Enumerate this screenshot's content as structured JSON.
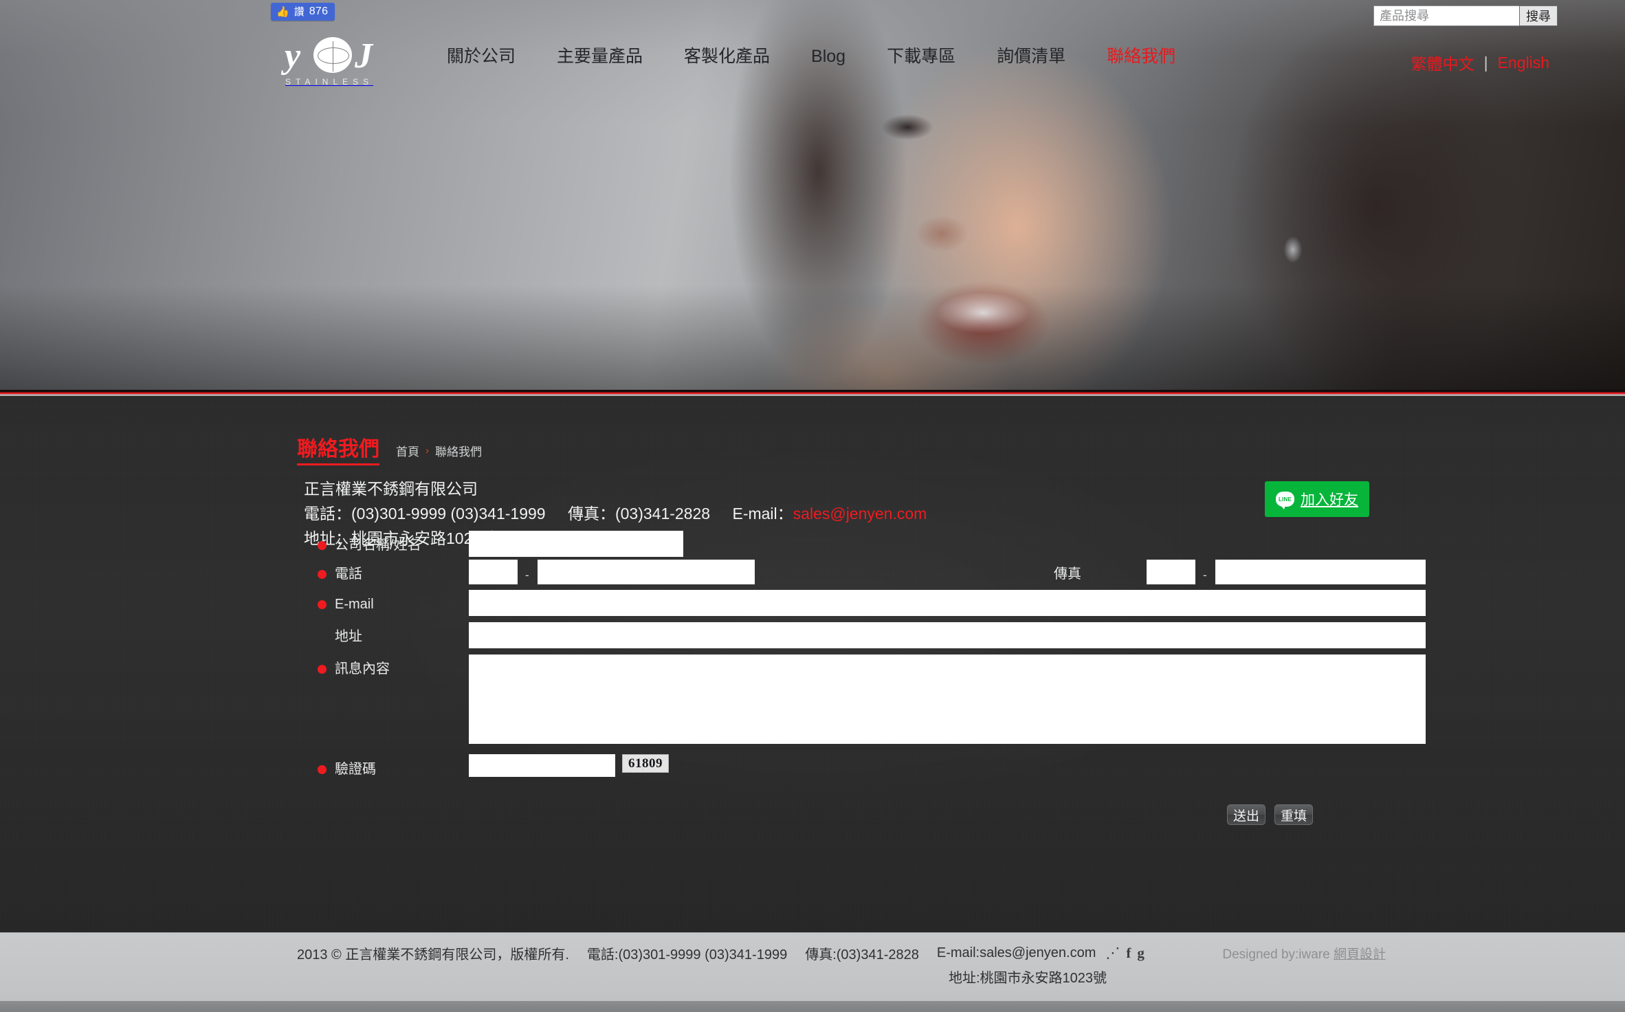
{
  "social_bar": {
    "fb_like_label": "讚",
    "fb_like_count": "876",
    "thumb_icon": "thumbs-up-icon"
  },
  "brand": {
    "logo_text_left": "y",
    "logo_text_right": "J",
    "logo_subtitle": "STAINLESS"
  },
  "nav": {
    "items": [
      {
        "label": "關於公司",
        "accent": false
      },
      {
        "label": "主要量產品",
        "accent": false
      },
      {
        "label": "客製化產品",
        "accent": false
      },
      {
        "label": "Blog",
        "accent": false
      },
      {
        "label": "下載專區",
        "accent": false
      },
      {
        "label": "詢價清單",
        "accent": false
      },
      {
        "label": "聯絡我們",
        "accent": true
      }
    ]
  },
  "search": {
    "placeholder": "產品搜尋",
    "value": "",
    "button_label": "搜尋"
  },
  "lang": {
    "zh_label": "繁體中文",
    "separator": "|",
    "en_label": "English"
  },
  "page": {
    "title": "聯絡我們",
    "breadcrumb_home": "首頁",
    "breadcrumb_arrow": "›",
    "breadcrumb_current": "聯絡我們"
  },
  "company": {
    "name": "正言權業不銹鋼有限公司",
    "phone_label": "電話：",
    "phone_value": "(03)301-9999 (03)341-1999",
    "fax_label": "傳真：",
    "fax_value": "(03)341-2828",
    "email_label": "E-mail：",
    "email_value": "sales@jenyen.com",
    "address_label": "地址：",
    "address_value": "桃園市永安路1023號"
  },
  "line_button": {
    "badge": "LINE",
    "label": "加入好友"
  },
  "form": {
    "company_name": {
      "label": "公司名稱/姓名",
      "required": true,
      "value": ""
    },
    "phone": {
      "label": "電話",
      "required": true,
      "area_value": "",
      "number_value": "",
      "dash": "-"
    },
    "fax": {
      "label": "傳真",
      "required": false,
      "area_value": "",
      "number_value": "",
      "dash": "-"
    },
    "email": {
      "label": "E-mail",
      "required": true,
      "value": ""
    },
    "address": {
      "label": "地址",
      "required": false,
      "value": ""
    },
    "message": {
      "label": "訊息內容",
      "required": true,
      "value": ""
    },
    "captcha": {
      "label": "驗證碼",
      "required": true,
      "value": "",
      "code": "61809"
    },
    "submit_label": "送出",
    "reset_label": "重填"
  },
  "footer": {
    "copyright": "2013 © 正言權業不銹鋼有限公司，版權所有.",
    "phone": "電話:(03)301-9999 (03)341-1999",
    "fax": "傳真:(03)341-2828",
    "email": "E-mail:sales@jenyen.com",
    "address": "地址:桃園市永安路1023號",
    "social_icons": [
      "rss-icon",
      "facebook-icon",
      "google-plus-icon"
    ],
    "rss_glyph": "🔊",
    "facebook_glyph": "f",
    "google_glyph": "g",
    "designed_prefix": "Designed by:iware ",
    "designed_link": "網頁設計"
  },
  "colors": {
    "accent_red": "#ef1b20",
    "line_green": "#07b53b",
    "fb_blue": "#4267d4",
    "dark_bg": "#2b2b2b",
    "footer_bg": "#c5c7c9"
  }
}
